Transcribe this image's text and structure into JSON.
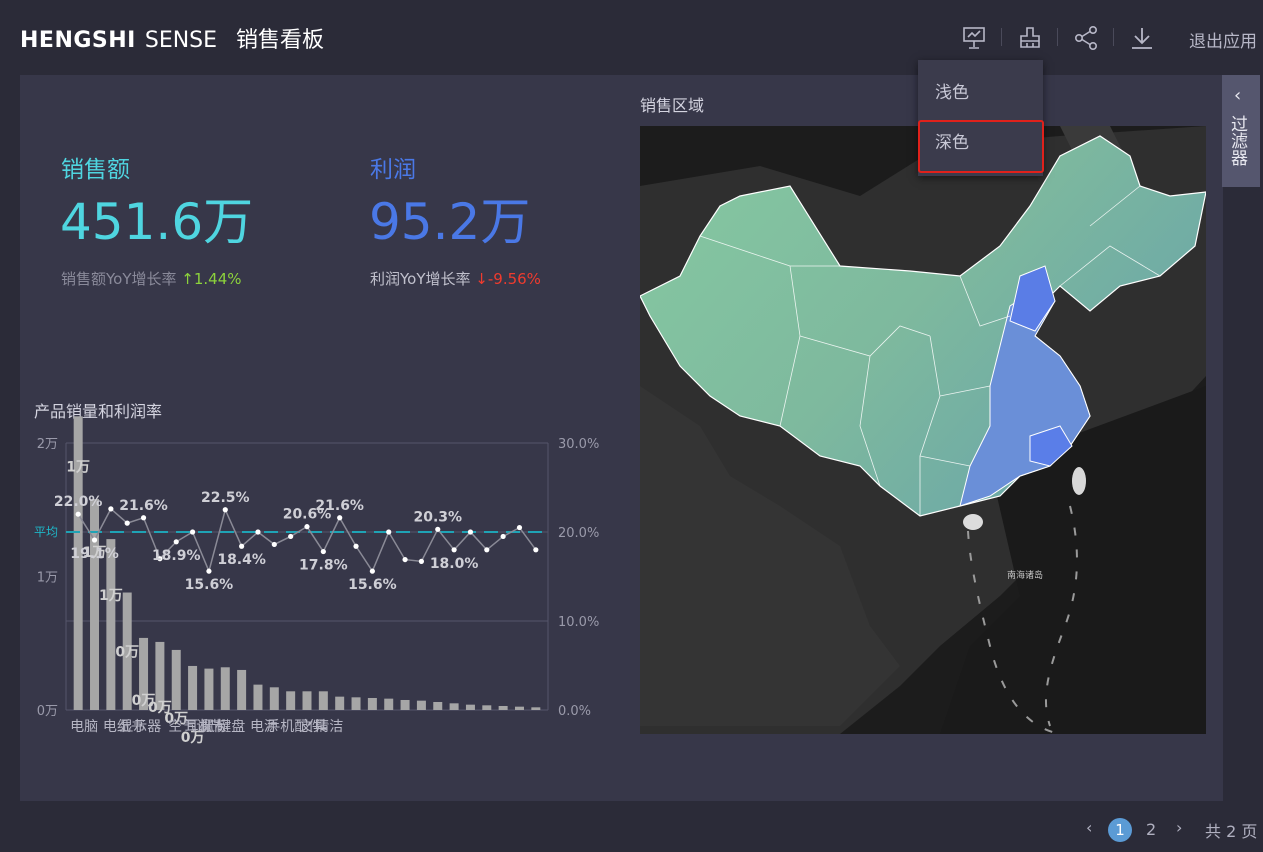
{
  "header": {
    "brand_bold": "HENGSHI",
    "brand_light": "SENSE",
    "page_title": "销售看板",
    "exit_label": "退出应用",
    "icons": [
      "presentation-icon",
      "brush-icon",
      "share-icon",
      "download-icon"
    ]
  },
  "theme_menu": {
    "items": [
      "浅色",
      "深色"
    ],
    "highlighted": "深色"
  },
  "filter_panel": {
    "label": "过滤器"
  },
  "kpis": [
    {
      "title": "销售额",
      "value": "451.6万",
      "sub_label": "销售额YoY增长率",
      "change": "1.44%",
      "direction": "up",
      "color": "#4fd5e0"
    },
    {
      "title": "利润",
      "value": "95.2万",
      "sub_label": "利润YoY增长率",
      "change": "-9.56%",
      "direction": "down",
      "color": "#4a78e6"
    }
  ],
  "map": {
    "title": "销售区域",
    "sea_label": "南海诸岛"
  },
  "pagination": {
    "current": "1",
    "next": "2",
    "total": "共 2 页"
  },
  "chart_data": {
    "type": "bar",
    "title": "产品销量和利润率",
    "categories": [
      "电脑",
      "",
      "电纸书",
      "显示器",
      "",
      "",
      "空气调节",
      "耳机",
      "鼠标",
      "键盘",
      "",
      "电源",
      "手机配件",
      "",
      "文具",
      "清洁",
      "",
      "",
      "",
      "",
      "",
      "",
      "",
      "",
      "",
      "",
      "",
      "",
      ""
    ],
    "tick_labels": [
      "电脑",
      "电纸书",
      "显示器",
      "空气调节",
      "耳机",
      "鼠标",
      "键盘",
      "电源",
      "手机配件",
      "文具",
      "清洁"
    ],
    "y_left_ticks": [
      "0万",
      "1万",
      "2万"
    ],
    "y_right_ticks": [
      "0.0%",
      "10.0%",
      "20.0%",
      "30.0%"
    ],
    "ylim_left": [
      0,
      20000
    ],
    "ylim_right": [
      0,
      30
    ],
    "series": [
      {
        "name": "销量",
        "type": "bar",
        "values": [
          22000,
          15800,
          12800,
          8800,
          5400,
          5100,
          4500,
          3300,
          3100,
          3200,
          3000,
          1900,
          1700,
          1400,
          1400,
          1400,
          1000,
          950,
          900,
          850,
          750,
          700,
          600,
          500,
          400,
          350,
          300,
          250,
          200
        ]
      },
      {
        "name": "利润率",
        "type": "line",
        "values": [
          22.0,
          19.1,
          22.6,
          21.0,
          21.6,
          17.0,
          18.9,
          20.0,
          15.6,
          22.5,
          18.4,
          20.0,
          18.6,
          19.5,
          20.6,
          17.8,
          21.6,
          18.4,
          15.6,
          20.0,
          16.9,
          16.7,
          20.3,
          18.0,
          20.0,
          18.0,
          19.5,
          20.5,
          18.0
        ]
      },
      {
        "name": "平均",
        "type": "reference",
        "values": [
          20.0
        ]
      }
    ],
    "bar_labels": [
      "1万",
      "1万",
      "1万",
      "0万",
      "0万",
      "0万",
      "0万",
      "0万"
    ],
    "line_labels": [
      "22.0%",
      "19.1%",
      "21.6%",
      "18.9%",
      "15.6%",
      "22.5%",
      "18.4%",
      "20.6%",
      "17.8%",
      "21.6%",
      "15.6%",
      "20.3%",
      "18.0%"
    ],
    "ref_label": "平均"
  }
}
